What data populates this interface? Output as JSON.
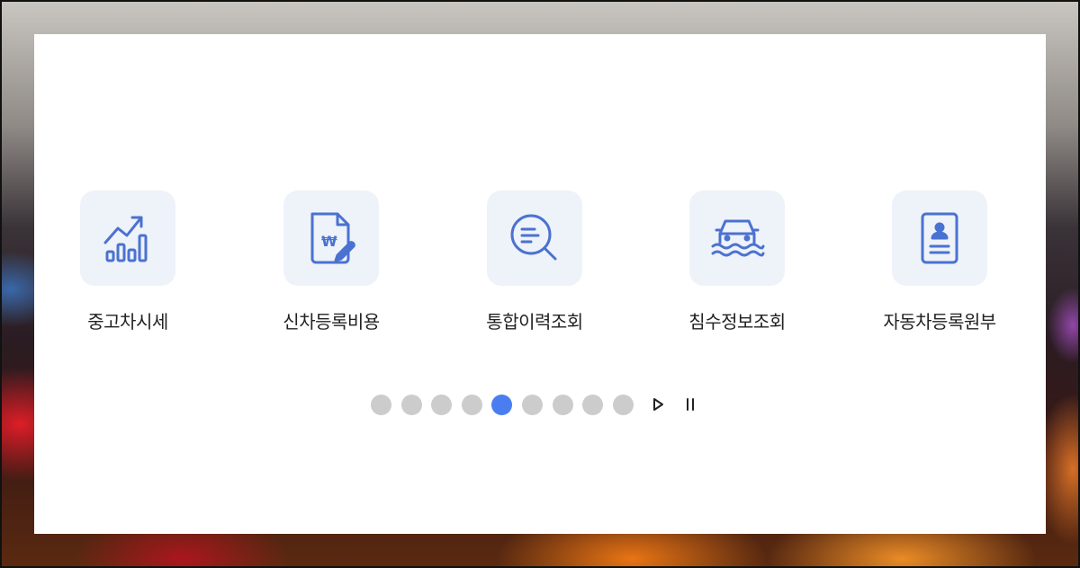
{
  "colors": {
    "accent": "#4a7ef0",
    "icon_stroke": "#4a72d0",
    "tile_bg": "#eef2f9",
    "dot_inactive": "#cccccc"
  },
  "menu": {
    "items": [
      {
        "label": "중고차시세",
        "icon": "rising-chart-icon"
      },
      {
        "label": "신차등록비용",
        "icon": "won-document-icon"
      },
      {
        "label": "통합이력조회",
        "icon": "document-search-icon"
      },
      {
        "label": "침수정보조회",
        "icon": "flooded-car-icon"
      },
      {
        "label": "자동차등록원부",
        "icon": "id-card-icon"
      }
    ]
  },
  "icon_glyphs": {
    "won": "₩"
  },
  "pager": {
    "total_dots": 9,
    "active_index": 4,
    "play_icon": "play-icon",
    "pause_icon": "pause-icon"
  }
}
